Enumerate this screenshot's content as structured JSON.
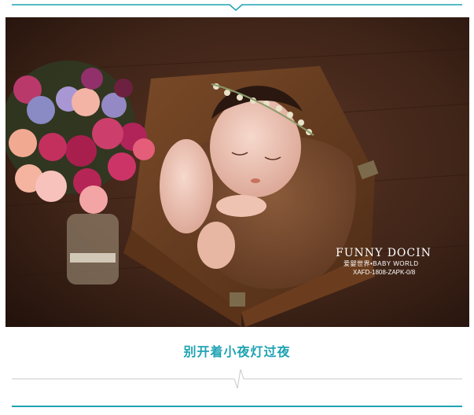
{
  "photo": {
    "watermark_brand": "FUNNY DOCIN",
    "watermark_sub": "爱婴世界•BABY WORLD",
    "watermark_code": "XAFD-1808-ZAPK-0/8"
  },
  "caption": "别开着小夜灯过夜",
  "colors": {
    "accent": "#1fa3b3",
    "rule_gray": "#c8c8c8"
  }
}
